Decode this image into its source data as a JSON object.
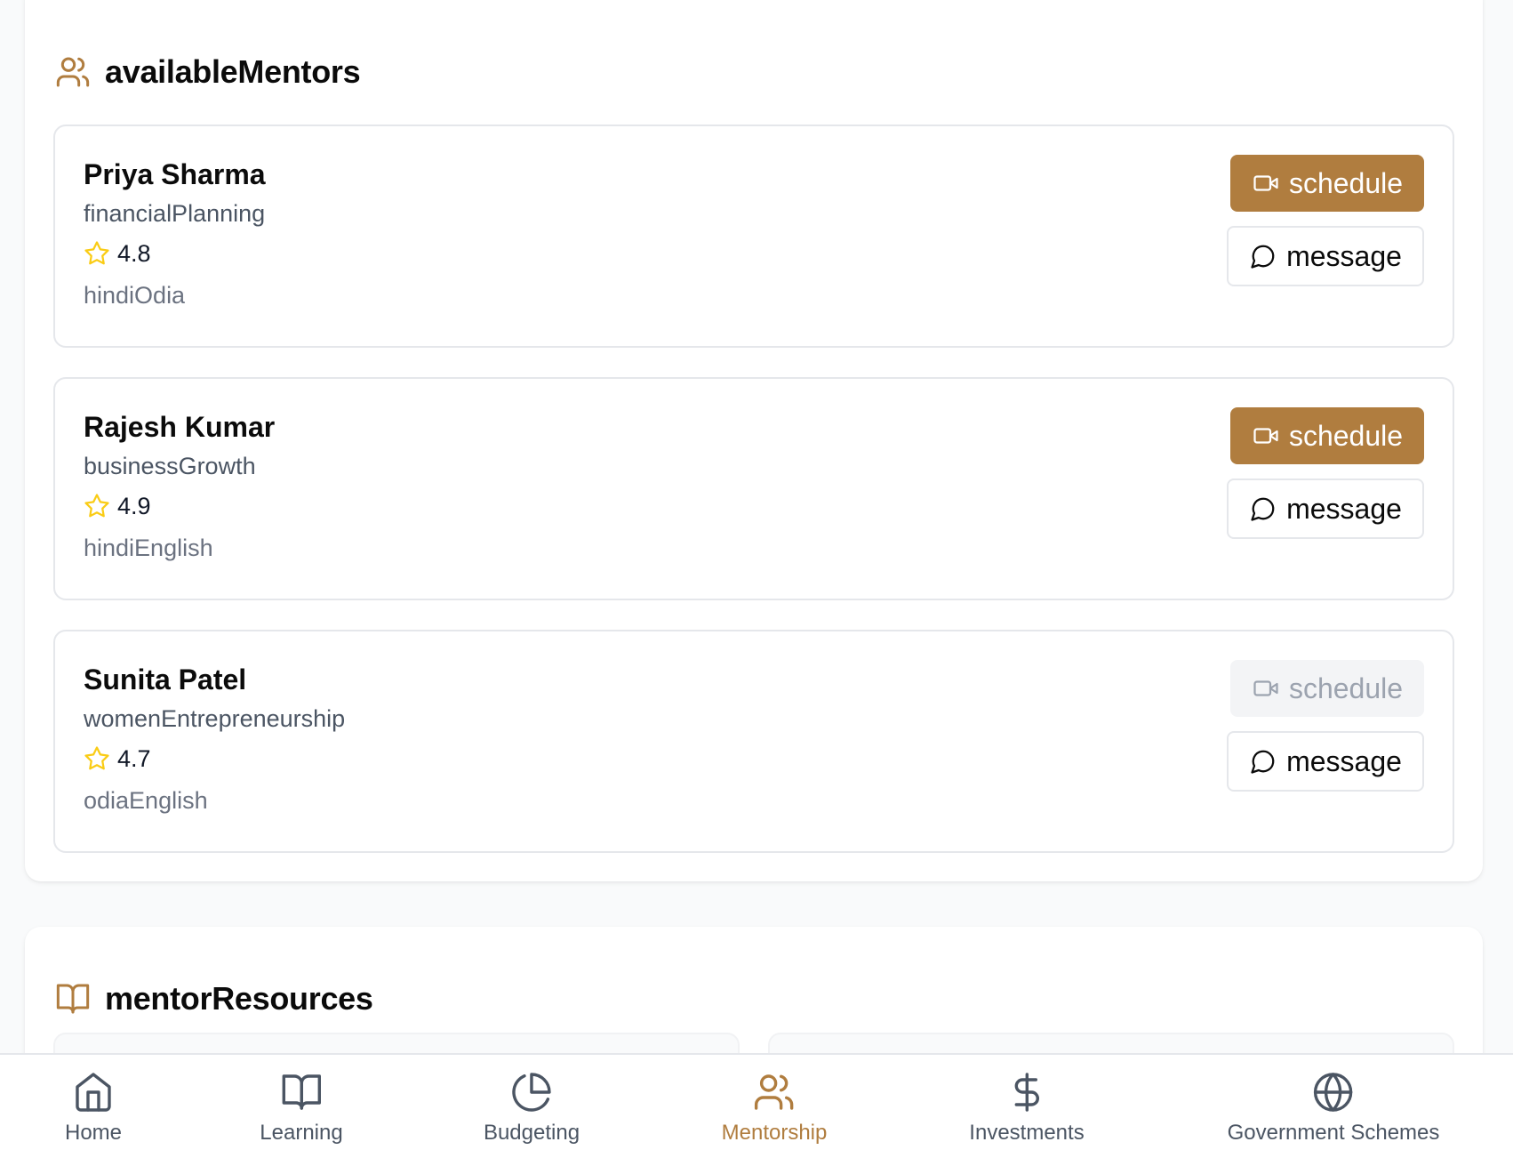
{
  "colors": {
    "accent": "#b07d3f",
    "star": "#facc15",
    "muted_text": "#6b7280",
    "icon_gray": "#4b5563",
    "disabled_bg": "#f3f4f6",
    "disabled_text": "#9ca3af"
  },
  "mentors_section": {
    "icon": "users-icon",
    "title": "availableMentors",
    "mentors": [
      {
        "name": "Priya Sharma",
        "specialty": "financialPlanning",
        "rating": "4.8",
        "languages": "hindiOdia",
        "schedule_label": "schedule",
        "message_label": "message",
        "schedule_enabled": true
      },
      {
        "name": "Rajesh Kumar",
        "specialty": "businessGrowth",
        "rating": "4.9",
        "languages": "hindiEnglish",
        "schedule_label": "schedule",
        "message_label": "message",
        "schedule_enabled": true
      },
      {
        "name": "Sunita Patel",
        "specialty": "womenEntrepreneurship",
        "rating": "4.7",
        "languages": "odiaEnglish",
        "schedule_label": "schedule",
        "message_label": "message",
        "schedule_enabled": false
      }
    ]
  },
  "resources_section": {
    "icon": "book-open-icon",
    "title": "mentorResources"
  },
  "bottom_nav": {
    "active": "Mentorship",
    "items": [
      {
        "label": "Home",
        "icon": "home-icon"
      },
      {
        "label": "Learning",
        "icon": "book-open-icon"
      },
      {
        "label": "Budgeting",
        "icon": "pie-chart-icon"
      },
      {
        "label": "Mentorship",
        "icon": "users-icon"
      },
      {
        "label": "Investments",
        "icon": "dollar-sign-icon"
      },
      {
        "label": "Government Schemes",
        "icon": "globe-icon"
      }
    ]
  }
}
